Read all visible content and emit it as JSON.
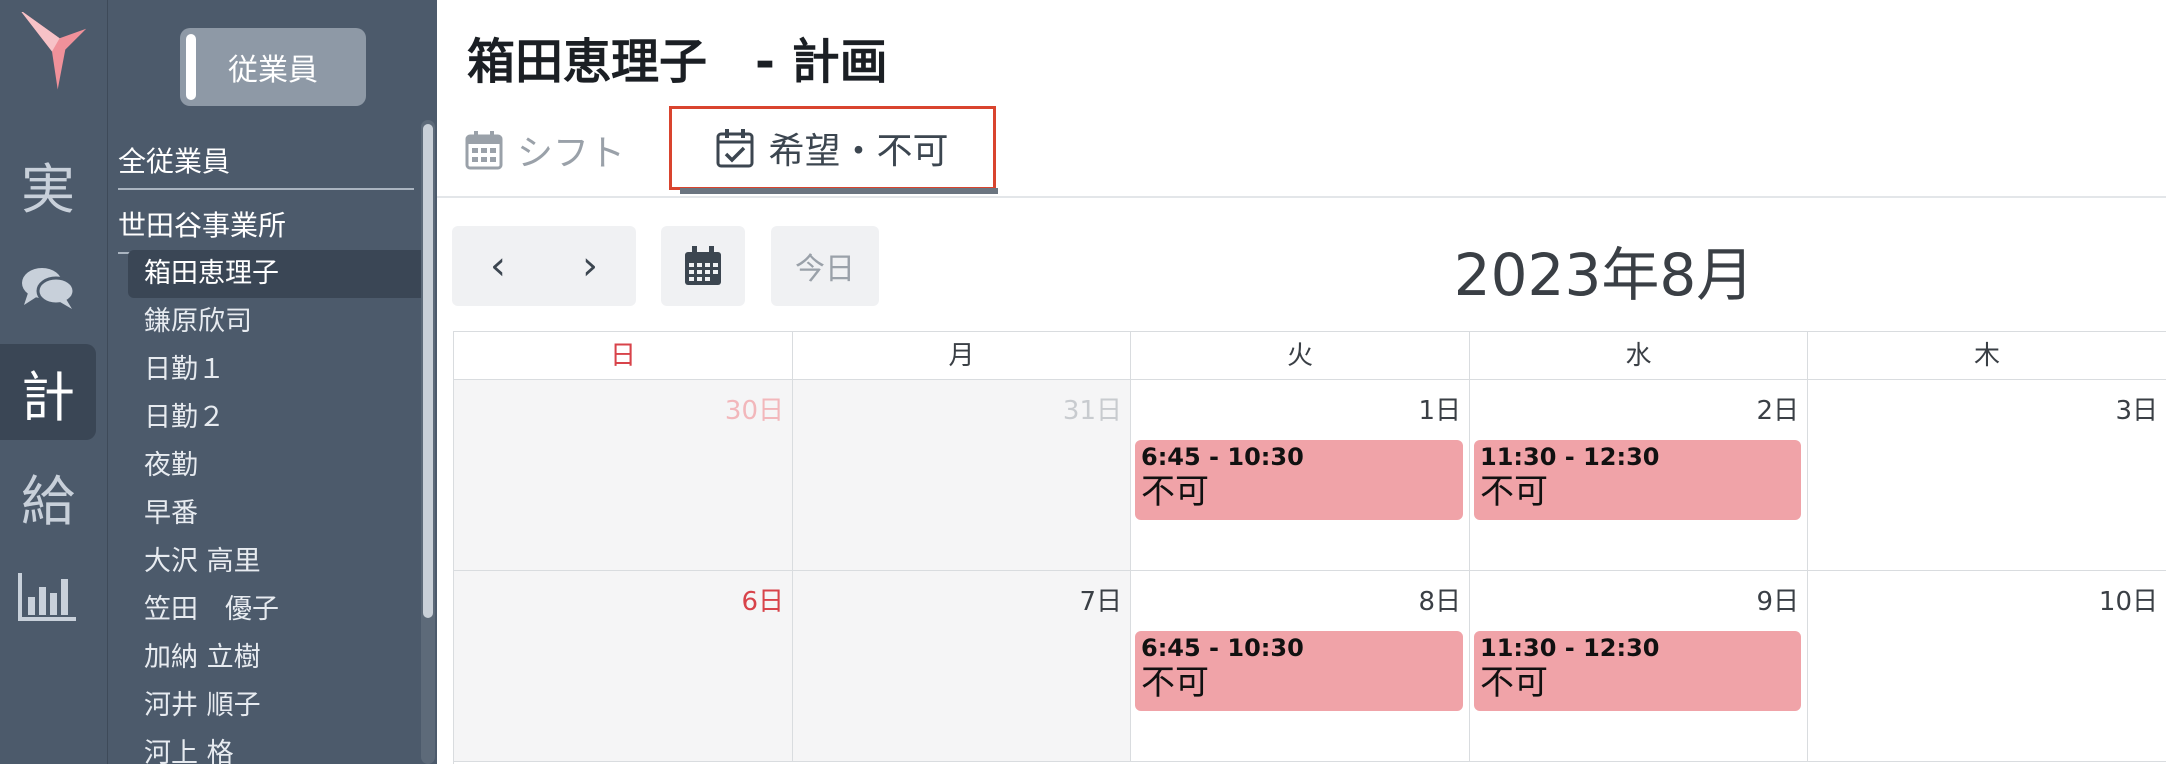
{
  "rail": {
    "items": [
      {
        "glyph": "実"
      },
      {
        "glyph": ""
      },
      {
        "glyph": "計"
      },
      {
        "glyph": "給"
      },
      {
        "glyph": ""
      }
    ],
    "active_index": 2
  },
  "panel": {
    "toggle_label": "従業員",
    "all_employees_label": "全従業員",
    "office_label": "世田谷事業所",
    "employees": [
      "箱田恵理子",
      "鎌原欣司",
      "日勤１",
      "日勤２",
      "夜勤",
      "早番",
      "大沢 高里",
      "笠田　優子",
      "加納 立樹",
      "河井 順子",
      "河上 格"
    ],
    "selected_index": 0
  },
  "header": {
    "title": "箱田恵理子　- 計画",
    "tabs": [
      {
        "label": "シフト",
        "icon": "calendar-icon"
      },
      {
        "label": "希望・不可",
        "icon": "calendar-check-icon"
      }
    ],
    "active_tab": 1
  },
  "toolbar": {
    "prev_symbol": "‹",
    "next_symbol": "›",
    "today_label": "今日",
    "month_title": "2023年8月"
  },
  "calendar": {
    "weekdays": [
      "日",
      "月",
      "火",
      "水",
      "木"
    ],
    "weeks": [
      [
        {
          "day": "30日",
          "style": "other-sun",
          "gray": true
        },
        {
          "day": "31日",
          "style": "other",
          "gray": true
        },
        {
          "day": "1日",
          "style": "",
          "event": {
            "time": "6:45 - 10:30",
            "label": "不可"
          }
        },
        {
          "day": "2日",
          "style": "",
          "event": {
            "time": "11:30 - 12:30",
            "label": "不可"
          }
        },
        {
          "day": "3日",
          "style": ""
        }
      ],
      [
        {
          "day": "6日",
          "style": "sun",
          "gray": true
        },
        {
          "day": "7日",
          "style": "",
          "gray": true
        },
        {
          "day": "8日",
          "style": "",
          "event": {
            "time": "6:45 - 10:30",
            "label": "不可"
          }
        },
        {
          "day": "9日",
          "style": "",
          "event": {
            "time": "11:30 - 12:30",
            "label": "不可"
          }
        },
        {
          "day": "10日",
          "style": ""
        }
      ]
    ]
  },
  "colors": {
    "sidebar_bg": "#4c5a6b",
    "event_bg": "#f0a3a8",
    "sunday": "#d8434a",
    "highlight_border": "#d9442e"
  }
}
